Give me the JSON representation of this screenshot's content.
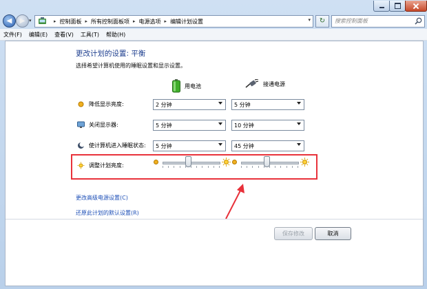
{
  "window": {
    "minimize_icon": "minimize-icon",
    "maximize_icon": "maximize-icon",
    "close_icon": "close-icon"
  },
  "address_bar": {
    "breadcrumbs": [
      "控制面板",
      "所有控制面板项",
      "电源选项",
      "编辑计划设置"
    ]
  },
  "search": {
    "placeholder": "搜索控制面板"
  },
  "menu": [
    "文件(F)",
    "编辑(E)",
    "查看(V)",
    "工具(T)",
    "帮助(H)"
  ],
  "page": {
    "title": "更改计划的设置: 平衡",
    "subtitle": "选择希望计算机使用的睡眠设置和显示设置。"
  },
  "columns": {
    "battery": "用电池",
    "plugged": "接通电源"
  },
  "settings": [
    {
      "label": "降低显示亮度:",
      "battery": "2 分钟",
      "plugged": "5 分钟"
    },
    {
      "label": "关闭显示器:",
      "battery": "5 分钟",
      "plugged": "10 分钟"
    },
    {
      "label": "使计算机进入睡眠状态:",
      "battery": "5 分钟",
      "plugged": "45 分钟"
    }
  ],
  "brightness": {
    "label": "调整计划亮度:",
    "battery_level": 0.45,
    "plugged_level": 0.45
  },
  "links": {
    "advanced": "更改高级电源设置(C)",
    "restore": "还原此计划的默认设置(R)"
  },
  "buttons": {
    "save": "保存修改",
    "cancel": "取消"
  },
  "colors": {
    "heading": "#1e3f8f",
    "link": "#1d4fb7",
    "highlight": "#e8313a"
  }
}
